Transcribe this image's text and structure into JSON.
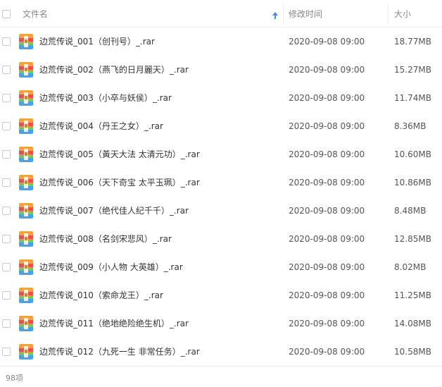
{
  "header": {
    "name_label": "文件名",
    "mtime_label": "修改时间",
    "size_label": "大小",
    "sort_icon": "sort-up-arrow-icon"
  },
  "colors": {
    "accent": "#3b8cff",
    "icon_orange": "#f4a23c",
    "icon_red": "#e8524a",
    "icon_blue": "#4aa3e8",
    "icon_green": "#7cc35a"
  },
  "file_icon": "archive-rar-icon",
  "files": [
    {
      "name": "边荒传说_001（创刊号）_.rar",
      "mtime": "2020-09-08 09:00",
      "size": "18.77MB"
    },
    {
      "name": "边荒传说_002（燕飞的日月麗天）_.rar",
      "mtime": "2020-09-08 09:00",
      "size": "15.27MB"
    },
    {
      "name": "边荒传说_003（小卒与妖侯）_.rar",
      "mtime": "2020-09-08 09:00",
      "size": "11.74MB"
    },
    {
      "name": "边荒传说_004（丹王之女）_.rar",
      "mtime": "2020-09-08 09:00",
      "size": "8.36MB"
    },
    {
      "name": "边荒传说_005（黃天大法 太清元功）_.rar",
      "mtime": "2020-09-08 09:00",
      "size": "10.60MB"
    },
    {
      "name": "边荒传说_006（天下奇宝 太平玉珮）_.rar",
      "mtime": "2020-09-08 09:00",
      "size": "10.86MB"
    },
    {
      "name": "边荒传说_007（绝代佳人纪千千）_.rar",
      "mtime": "2020-09-08 09:00",
      "size": "8.48MB"
    },
    {
      "name": "边荒传说_008（名剑宋悲风）_.rar",
      "mtime": "2020-09-08 09:00",
      "size": "12.85MB"
    },
    {
      "name": "边荒传说_009（小人物 大英雄）_.rar",
      "mtime": "2020-09-08 09:00",
      "size": "8.02MB"
    },
    {
      "name": "边荒传说_010（索命龙王）_.rar",
      "mtime": "2020-09-08 09:00",
      "size": "11.25MB"
    },
    {
      "name": "边荒传说_011（绝地绝险绝生机）_.rar",
      "mtime": "2020-09-08 09:00",
      "size": "14.08MB"
    },
    {
      "name": "边荒传说_012（九死一生 非常任务）_.rar",
      "mtime": "2020-09-08 09:00",
      "size": "10.58MB"
    }
  ],
  "footer": {
    "count_label": "98项"
  }
}
